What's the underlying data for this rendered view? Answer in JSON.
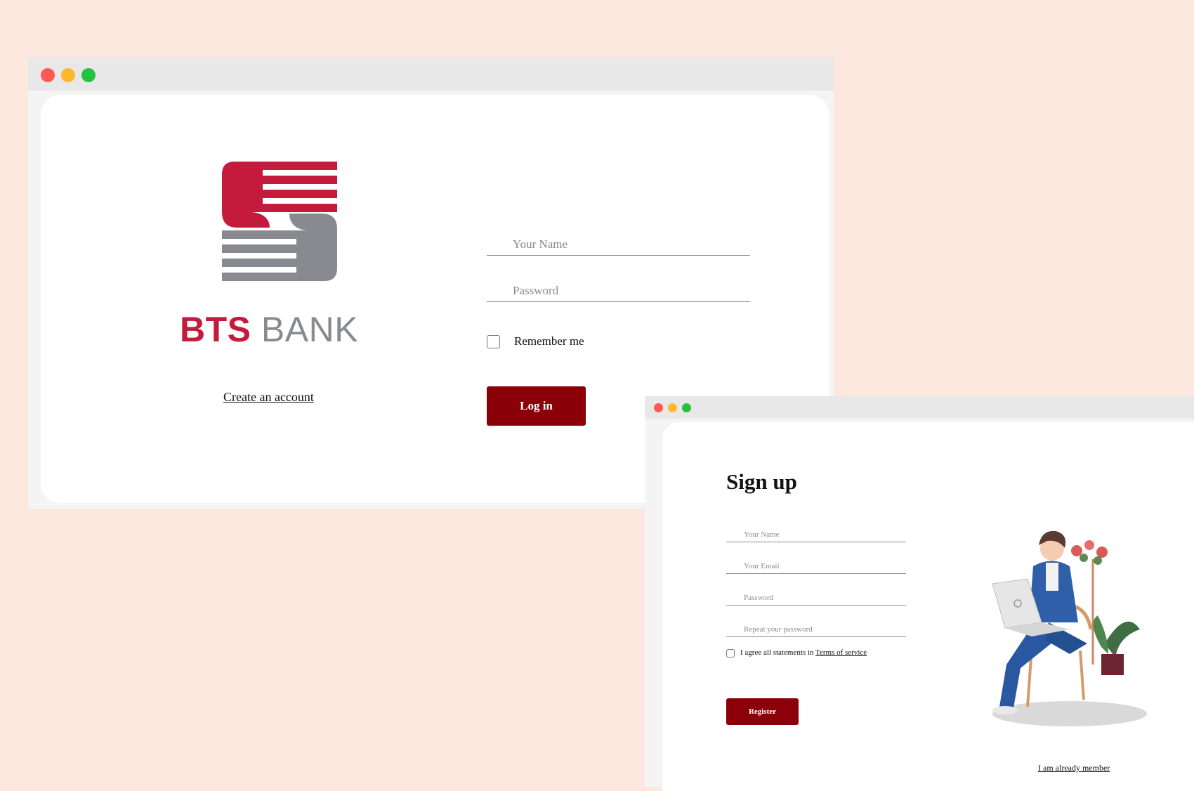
{
  "login_window": {
    "brand": {
      "word_bold": "BTS",
      "word_light": "BANK",
      "colors": {
        "primary": "#c41a3b",
        "secondary": "#888a8f"
      }
    },
    "create_account": "Create an account",
    "name_placeholder": "Your Name",
    "password_placeholder": "Password",
    "remember_label": "Remember me",
    "login_label": "Log in"
  },
  "signup_window": {
    "title": "Sign up",
    "name_placeholder": "Your Name",
    "email_placeholder": "Your Email",
    "password_placeholder": "Password",
    "repeat_placeholder": "Repeat your password",
    "agree_prefix": "I agree all statements in ",
    "terms_link": "Terms of service",
    "register_label": "Register",
    "already_member": "I am already member"
  },
  "colors": {
    "background": "#fde8df",
    "button": "#8b0008",
    "close": "#fd5a55",
    "minimize": "#fdb92e",
    "maximize": "#26c23f"
  }
}
